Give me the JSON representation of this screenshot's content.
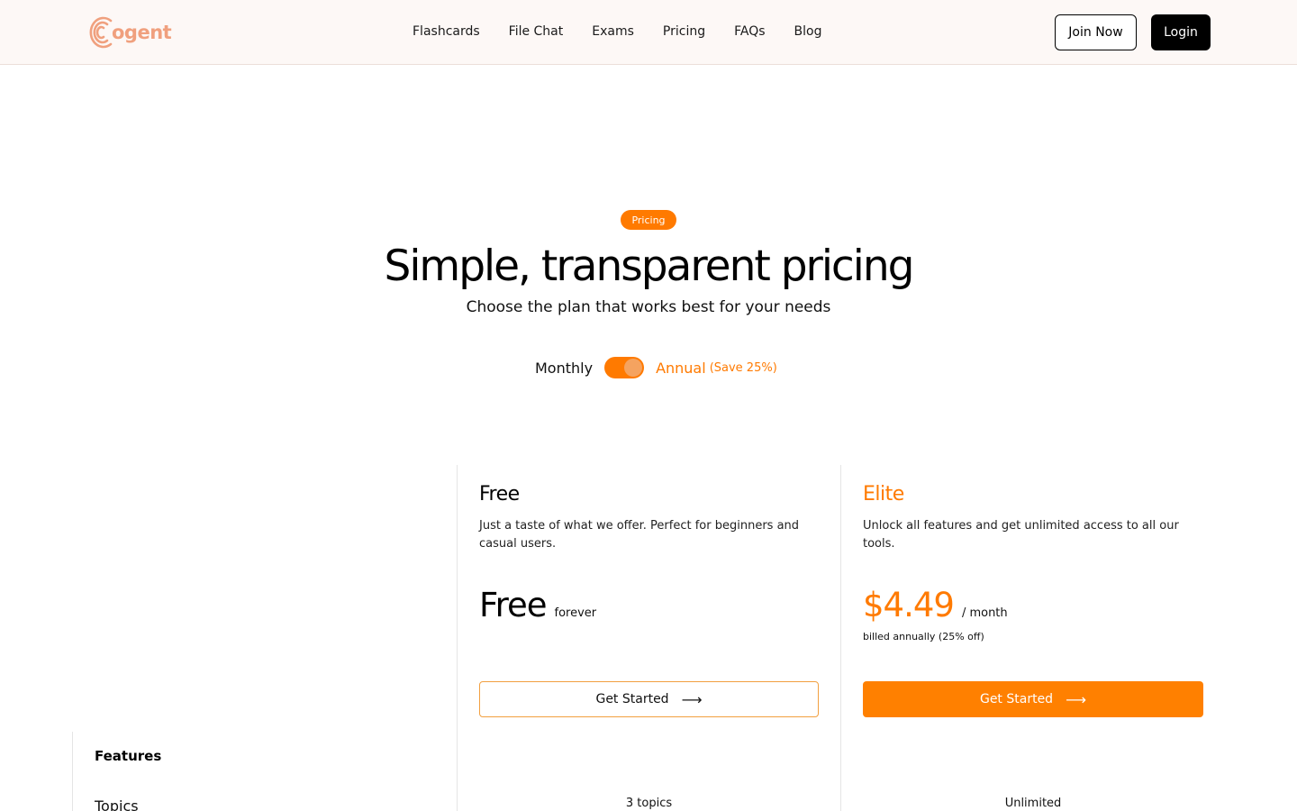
{
  "header": {
    "logo_text": "ogent",
    "nav": [
      "Flashcards",
      "File Chat",
      "Exams",
      "Pricing",
      "FAQs",
      "Blog"
    ],
    "join_label": "Join Now",
    "login_label": "Login"
  },
  "hero": {
    "badge": "Pricing",
    "title": "Simple, transparent pricing",
    "subtitle": "Choose the plan that works best for your needs",
    "toggle": {
      "monthly": "Monthly",
      "annual": "Annual",
      "save": "(Save 25%)",
      "annual_selected": true
    }
  },
  "plans": [
    {
      "name": "Free",
      "description": "Just a taste of what we offer. Perfect for beginners and casual users.",
      "price": "Free",
      "price_unit": "forever",
      "cta": "Get Started",
      "topics": "3 topics"
    },
    {
      "name": "Elite",
      "description": "Unlock all features and get unlimited access to all our tools.",
      "price": "$4.49",
      "price_unit": "/ month",
      "billed": "billed annually (25% off)",
      "cta": "Get Started",
      "topics": "Unlimited"
    }
  ],
  "features": {
    "heading": "Features",
    "rows": [
      "Topics"
    ]
  },
  "colors": {
    "accent": "#ff7a00",
    "logo": "#f0a07e",
    "header_bg": "#fdf8f6"
  }
}
